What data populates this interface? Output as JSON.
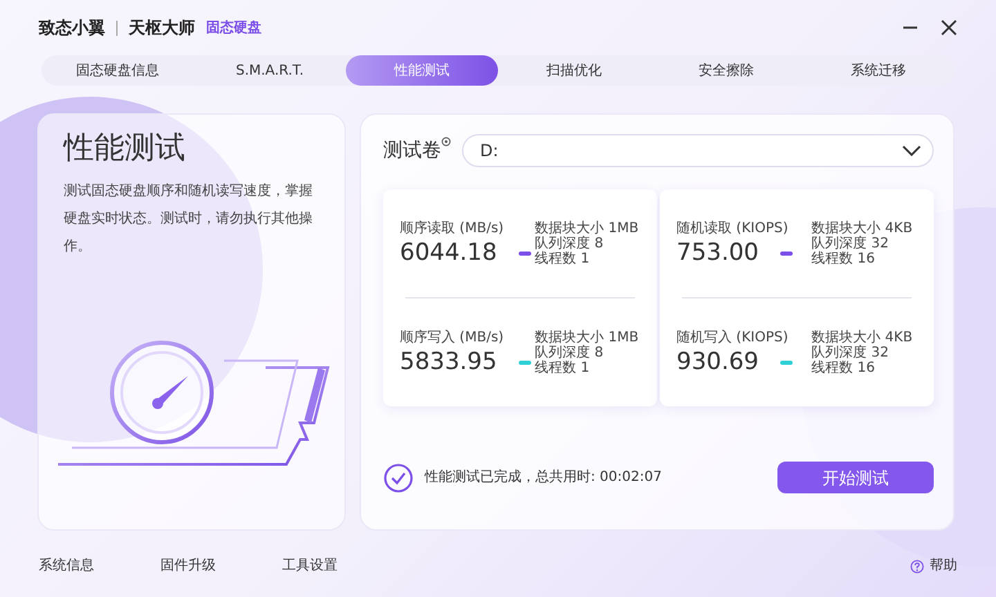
{
  "window": {
    "brand": "致态小翼",
    "product": "天枢大师",
    "product_tag": "固态硬盘"
  },
  "tabs": [
    {
      "label": "固态硬盘信息",
      "selected": false
    },
    {
      "label": "S.M.A.R.T.",
      "selected": false
    },
    {
      "label": "性能测试",
      "selected": true
    },
    {
      "label": "扫描优化",
      "selected": false
    },
    {
      "label": "安全擦除",
      "selected": false
    },
    {
      "label": "系统迁移",
      "selected": false
    }
  ],
  "intro": {
    "title": "性能测试",
    "description": "测试固态硬盘顺序和随机读写速度，掌握硬盘实时状态。测试时，请勿执行其他操作。"
  },
  "volume": {
    "label": "测试卷",
    "value": "D:"
  },
  "result_cards": [
    {
      "metrics": [
        {
          "name": "顺序读取 (MB/s)",
          "value": "6044.18",
          "color": "#7b4fe8",
          "details": [
            "数据块大小 1MB",
            "队列深度 8",
            "线程数 1"
          ]
        },
        {
          "name": "顺序写入 (MB/s)",
          "value": "5833.95",
          "color": "#2fd0d6",
          "details": [
            "数据块大小 1MB",
            "队列深度 8",
            "线程数 1"
          ]
        }
      ]
    },
    {
      "metrics": [
        {
          "name": "随机读取 (KIOPS)",
          "value": "753.00",
          "color": "#7b4fe8",
          "details": [
            "数据块大小 4KB",
            "队列深度 32",
            "线程数 16"
          ]
        },
        {
          "name": "随机写入 (KIOPS)",
          "value": "930.69",
          "color": "#2fd0d6",
          "details": [
            "数据块大小 4KB",
            "队列深度 32",
            "线程数 16"
          ]
        }
      ]
    }
  ],
  "status": {
    "completed": true,
    "text": "性能测试已完成，总共用时: 00:02:07"
  },
  "start_button": "开始测试",
  "footer": {
    "links": [
      "系统信息",
      "固件升级",
      "工具设置"
    ],
    "help": "帮助"
  }
}
